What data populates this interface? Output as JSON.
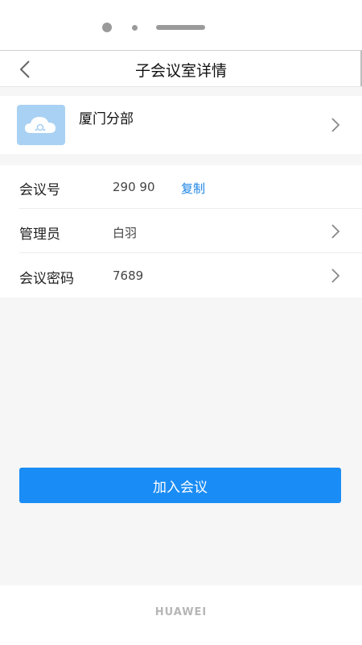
{
  "device": {
    "brand": "HUAWEI"
  },
  "navbar": {
    "title": "子会议室详情",
    "back_icon": "chevron-left-icon"
  },
  "branch": {
    "name": "厦门分部",
    "thumb_icon": "cloud-icon",
    "thumb_color": "#a9d1f3"
  },
  "info": {
    "meeting_id": {
      "label": "会议号",
      "value": "290 90",
      "copy_label": "复制"
    },
    "admin": {
      "label": "管理员",
      "value": "白羽"
    },
    "password": {
      "label": "会议密码",
      "value": "7689"
    }
  },
  "actions": {
    "join_label": "加入会议"
  },
  "colors": {
    "accent": "#1a8cf5",
    "link": "#1b84e6",
    "background": "#f6f6f6"
  }
}
